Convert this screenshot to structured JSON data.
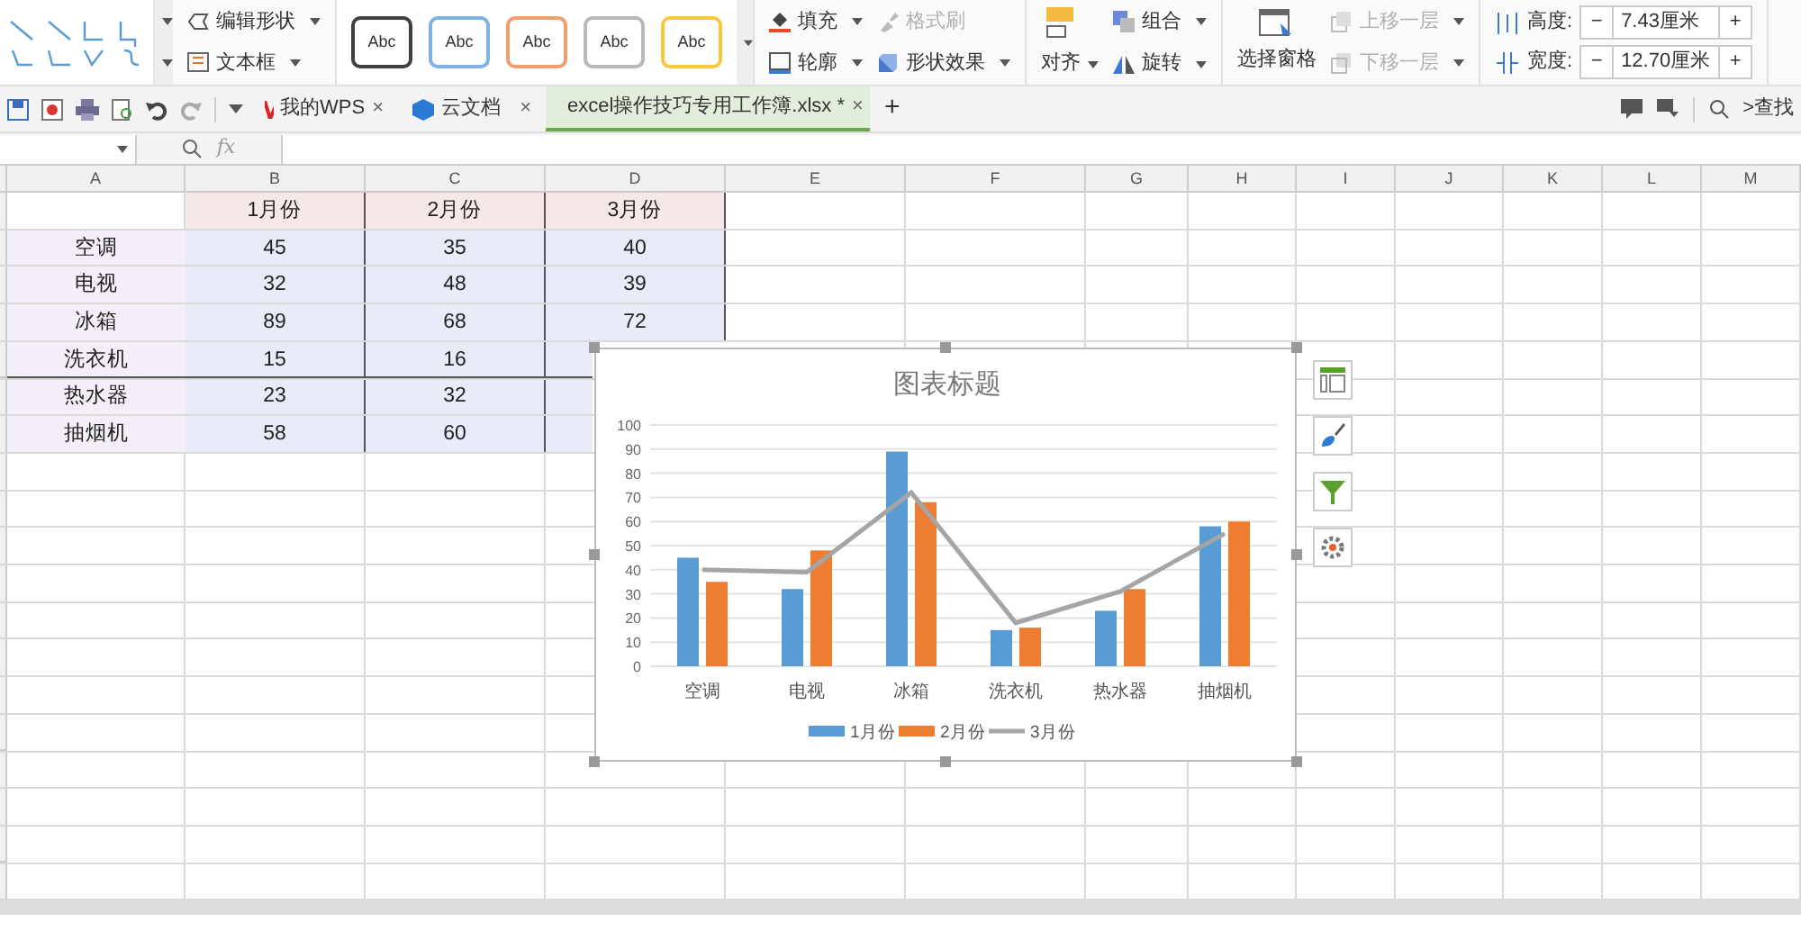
{
  "ribbon": {
    "edit_shape": "编辑形状",
    "text_box": "文本框",
    "style_presets": [
      {
        "label": "Abc",
        "color": "#404040"
      },
      {
        "label": "Abc",
        "color": "#7fb3e6"
      },
      {
        "label": "Abc",
        "color": "#f0a070"
      },
      {
        "label": "Abc",
        "color": "#b8b8b8"
      },
      {
        "label": "Abc",
        "color": "#f5c842"
      }
    ],
    "fill": "填充",
    "format_painter": {
      "label": "格式刷",
      "disabled": true
    },
    "outline": "轮廓",
    "shape_effects": "形状效果",
    "align": "对齐",
    "group": "组合",
    "rotate": "旋转",
    "selection_pane": "选择窗格",
    "bring_forward": {
      "label": "上移一层",
      "disabled": true
    },
    "send_backward": {
      "label": "下移一层",
      "disabled": true
    },
    "height": {
      "label": "高度:",
      "minus": "−",
      "value": "7.43厘米",
      "plus": "+"
    },
    "width": {
      "label": "宽度:",
      "minus": "−",
      "value": "12.70厘米",
      "plus": "+"
    }
  },
  "doc_tabs": [
    {
      "label": "我的WPS",
      "close": "×",
      "selected": false
    },
    {
      "label": "云文档",
      "close": "×",
      "selected": false
    },
    {
      "label": "excel操作技巧专用工作簿.xlsx *",
      "close": "×",
      "selected": true
    }
  ],
  "new_tab": "+",
  "search": ">查找",
  "formula_bar": {
    "fx": "fx"
  },
  "columns": [
    "A",
    "B",
    "C",
    "D",
    "E",
    "F",
    "G",
    "H",
    "I",
    "J",
    "K",
    "L",
    "M"
  ],
  "header_row": [
    "1月份",
    "2月份",
    "3月份"
  ],
  "rows": [
    [
      "空调",
      "45",
      "35",
      "40"
    ],
    [
      "电视",
      "32",
      "48",
      "39"
    ],
    [
      "冰箱",
      "89",
      "68",
      "72"
    ],
    [
      "洗衣机",
      "15",
      "16"
    ],
    [
      "热水器",
      "23",
      "32"
    ],
    [
      "抽烟机",
      "58",
      "60"
    ]
  ],
  "chart": {
    "chart_data": {
      "type": "bar",
      "title": "图表标题",
      "categories": [
        "空调",
        "电视",
        "冰箱",
        "洗衣机",
        "热水器",
        "抽烟机"
      ],
      "series": [
        {
          "name": "1月份",
          "color": "#5b9bd5",
          "values": [
            45,
            32,
            89,
            15,
            23,
            58
          ]
        },
        {
          "name": "2月份",
          "color": "#ed7d31",
          "values": [
            35,
            48,
            68,
            16,
            32,
            60
          ]
        },
        {
          "name": "3月份",
          "color": "#a5a5a5",
          "type": "line",
          "values": [
            40,
            39,
            72,
            18,
            31,
            55
          ]
        }
      ],
      "grid": true,
      "legend": true,
      "ylim": [
        0,
        100
      ],
      "yticks": [
        0,
        10,
        20,
        30,
        40,
        50,
        60,
        70,
        80,
        90,
        100
      ]
    }
  }
}
